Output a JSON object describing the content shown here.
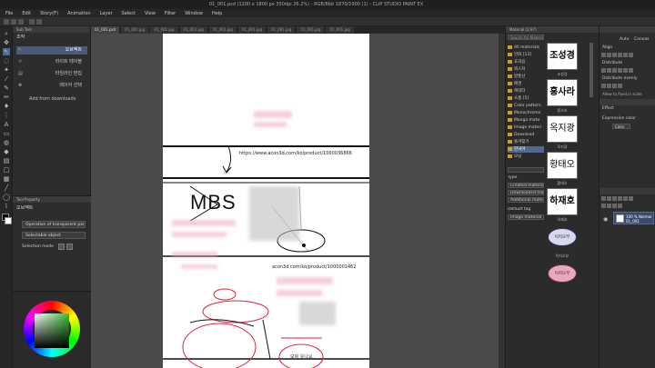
{
  "window": {
    "title": "01_001.psd (1200 x 1800 px 350dpi 26.2%) - RGB/8bit 1870/1900 (1) - CLIP STUDIO PAINT EX"
  },
  "menu": [
    "File",
    "Edit",
    "Story(F)",
    "Animation",
    "Layer",
    "Select",
    "View",
    "Filter",
    "Window",
    "Help"
  ],
  "doc_tabs": [
    "01_001.psd",
    "01_001.jpg",
    "01_001.jpg",
    "01_001.jpg",
    "01_001.jpg",
    "01_001.jpg",
    "01_001.jpg",
    "01_001.jpg",
    "01_001.jpg"
  ],
  "subtool": {
    "header": "Sub Tool",
    "title": "조작",
    "items": [
      {
        "label": "오브젝트",
        "icon": "↖"
      },
      {
        "label": "라이트 테이블",
        "icon": "☼"
      },
      {
        "label": "타임라인 편집",
        "icon": "▤"
      },
      {
        "label": "레이어 선택",
        "icon": "✥"
      }
    ],
    "add_downloads": "Add from downloads"
  },
  "tool_property": {
    "header": "Tool Property",
    "title": "오브젝트",
    "option1": "Operation of transparent part",
    "option2": "Selectable object",
    "selection_mode_label": "Selection mode"
  },
  "canvas": {
    "url1": "https://www.acon3d.com/ko/product/1000036866",
    "url2": "acon3d.com/ko/product/1000001462",
    "mbs": "MBS",
    "bubble_text": "모쥐 유나요"
  },
  "materials": {
    "header": "Material [2.97]",
    "search_placeholder": "Search for Materials",
    "tree": [
      "All materials",
      "만화 [13]",
      "효과음",
      "텍스처",
      "말풍선",
      "배경",
      "캐릭터",
      "소품 [5]",
      "Color pattern",
      "Monochrome",
      "Manga mate",
      "Image materi",
      "Download",
      "즐겨찾기",
      "한국어",
      "모닝"
    ],
    "thumbs": [
      {
        "text": "조성경",
        "caption": "조성경"
      },
      {
        "text": "홍사라",
        "caption": "홍사라"
      },
      {
        "text": "옥지광",
        "caption": "옥지광"
      },
      {
        "text": "황태오",
        "caption": "황태오"
      },
      {
        "text": "하재호",
        "caption": "하재호"
      },
      {
        "text": "이지오부",
        "caption": "이지오부"
      },
      {
        "text": "이지오부",
        "caption": "이지오부"
      }
    ],
    "tag_label": "Type",
    "types": [
      "Created material",
      "Downloaded mat",
      "Additional materia"
    ],
    "default_tag_label": "Default tag",
    "image_material": "Image material"
  },
  "right_panel": {
    "top_label": "Auto",
    "canvas_label": "Canvas",
    "align_label": "Align",
    "distribute_label": "Distribute",
    "distribute_evenly": "Distribute evenly",
    "allow_label": "Allow to fixed in scale",
    "effect_label": "Effect",
    "expression_label": "Expression color",
    "color_value": "Color",
    "layer_name": "100 % Normal",
    "layer_sub": "01_001"
  },
  "colors": {
    "accent": "#4a6a9a",
    "pink_highlight": "#e6a0b8",
    "wheel_center": "#36c23b"
  }
}
